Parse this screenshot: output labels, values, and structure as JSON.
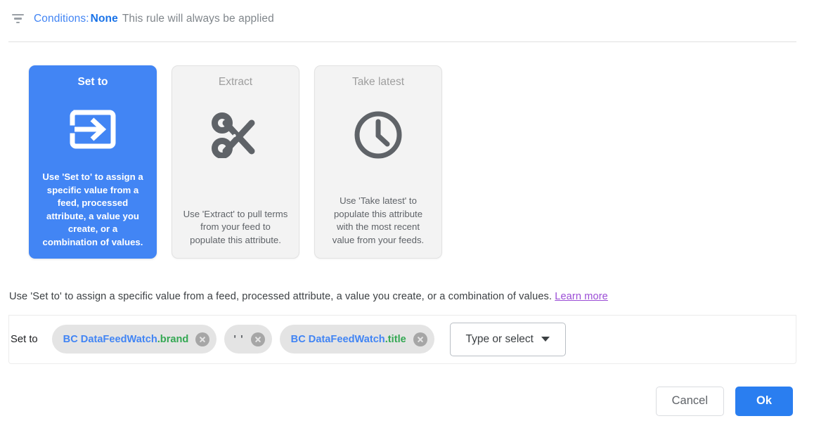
{
  "conditions": {
    "icon": "filter-icon",
    "label": "Conditions:",
    "value": "None",
    "description": "This rule will always be applied"
  },
  "cards": [
    {
      "id": "set-to",
      "title": "Set to",
      "icon": "arrow-into-box-icon",
      "description": "Use 'Set to' to assign a specific value from a feed, processed attribute, a value you create, or a combination of values.",
      "selected": true
    },
    {
      "id": "extract",
      "title": "Extract",
      "icon": "scissors-icon",
      "description": "Use 'Extract' to pull terms from your feed to populate this attribute.",
      "selected": false
    },
    {
      "id": "take-latest",
      "title": "Take latest",
      "icon": "clock-icon",
      "description": "Use 'Take latest' to populate this attribute with the most recent value from your feeds.",
      "selected": false
    }
  ],
  "description_line": {
    "text": "Use 'Set to' to assign a specific value from a feed, processed attribute, a value you create, or a combination of values.",
    "link_label": "Learn more"
  },
  "value_row": {
    "label": "Set to",
    "chips": [
      {
        "source": "BC DataFeedWatch",
        "attribute": ".brand",
        "literal": "",
        "remove_label": "×"
      },
      {
        "source": "",
        "attribute": "",
        "literal": "' '",
        "remove_label": "×"
      },
      {
        "source": "BC DataFeedWatch",
        "attribute": ".title",
        "literal": "",
        "remove_label": "×"
      }
    ],
    "select_placeholder": "Type or select"
  },
  "footer": {
    "cancel_label": "Cancel",
    "ok_label": "Ok"
  },
  "colors": {
    "accent_blue": "#4285f4",
    "ok_blue": "#2a7ef0",
    "chip_source_blue": "#4285f4",
    "chip_attribute_green": "#34a853",
    "link_purple": "#9b4dd6",
    "muted_gray": "#80868b"
  }
}
